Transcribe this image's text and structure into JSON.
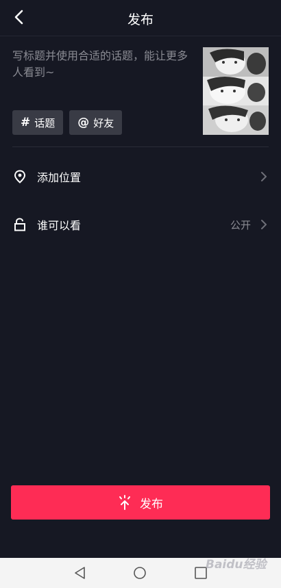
{
  "header": {
    "title": "发布"
  },
  "caption": {
    "placeholder": "写标题并使用合适的话题，能让更多人看到~"
  },
  "tags": [
    {
      "symbol": "#",
      "label": "话题"
    },
    {
      "symbol": "@",
      "label": "好友"
    }
  ],
  "rows": [
    {
      "label": "添加位置",
      "value": ""
    },
    {
      "label": "谁可以看",
      "value": "公开"
    }
  ],
  "publish_button": {
    "label": "发布"
  },
  "watermark": "Baidu经验",
  "colors": {
    "background": "#161823",
    "accent": "#fe2c55"
  },
  "icons": [
    "back-arrow-icon",
    "location-pin-icon",
    "unlock-icon",
    "chevron-right-icon",
    "publish-sparkle-icon",
    "nav-back-icon",
    "nav-home-icon",
    "nav-recent-icon"
  ]
}
